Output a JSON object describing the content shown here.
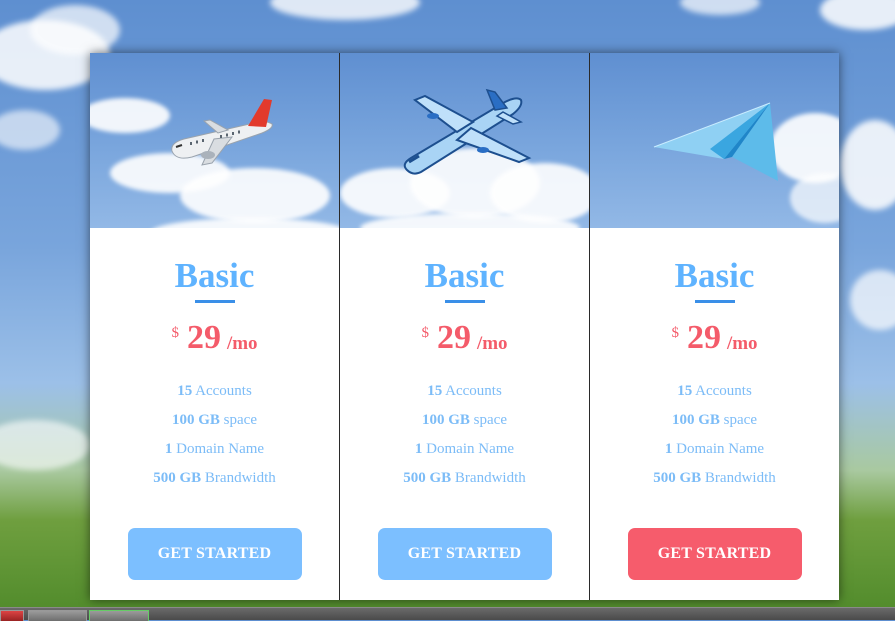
{
  "plans": [
    {
      "icon": "airliner-icon",
      "name": "Basic",
      "currency": "$",
      "amount": "29",
      "period": "/mo",
      "features": [
        {
          "value": "15",
          "label": "Accounts"
        },
        {
          "value": "100 GB",
          "label": "space"
        },
        {
          "value": "1",
          "label": "Domain Name"
        },
        {
          "value": "500 GB",
          "label": "Brandwidth"
        }
      ],
      "button": "GET STARTED",
      "button_color": "#7cbfff"
    },
    {
      "icon": "blue-jet-icon",
      "name": "Basic",
      "currency": "$",
      "amount": "29",
      "period": "/mo",
      "features": [
        {
          "value": "15",
          "label": "Accounts"
        },
        {
          "value": "100 GB",
          "label": "space"
        },
        {
          "value": "1",
          "label": "Domain Name"
        },
        {
          "value": "500 GB",
          "label": "Brandwidth"
        }
      ],
      "button": "GET STARTED",
      "button_color": "#7cbfff"
    },
    {
      "icon": "paper-plane-icon",
      "name": "Basic",
      "currency": "$",
      "amount": "29",
      "period": "/mo",
      "features": [
        {
          "value": "15",
          "label": "Accounts"
        },
        {
          "value": "100 GB",
          "label": "space"
        },
        {
          "value": "1",
          "label": "Domain Name"
        },
        {
          "value": "500 GB",
          "label": "Brandwidth"
        }
      ],
      "button": "GET STARTED",
      "button_color": "#f65c6c"
    }
  ],
  "colors": {
    "title": "#5fb3ff",
    "underline": "#3a8fe8",
    "price": "#f45b6a",
    "feature_text": "#7cbcf7"
  }
}
